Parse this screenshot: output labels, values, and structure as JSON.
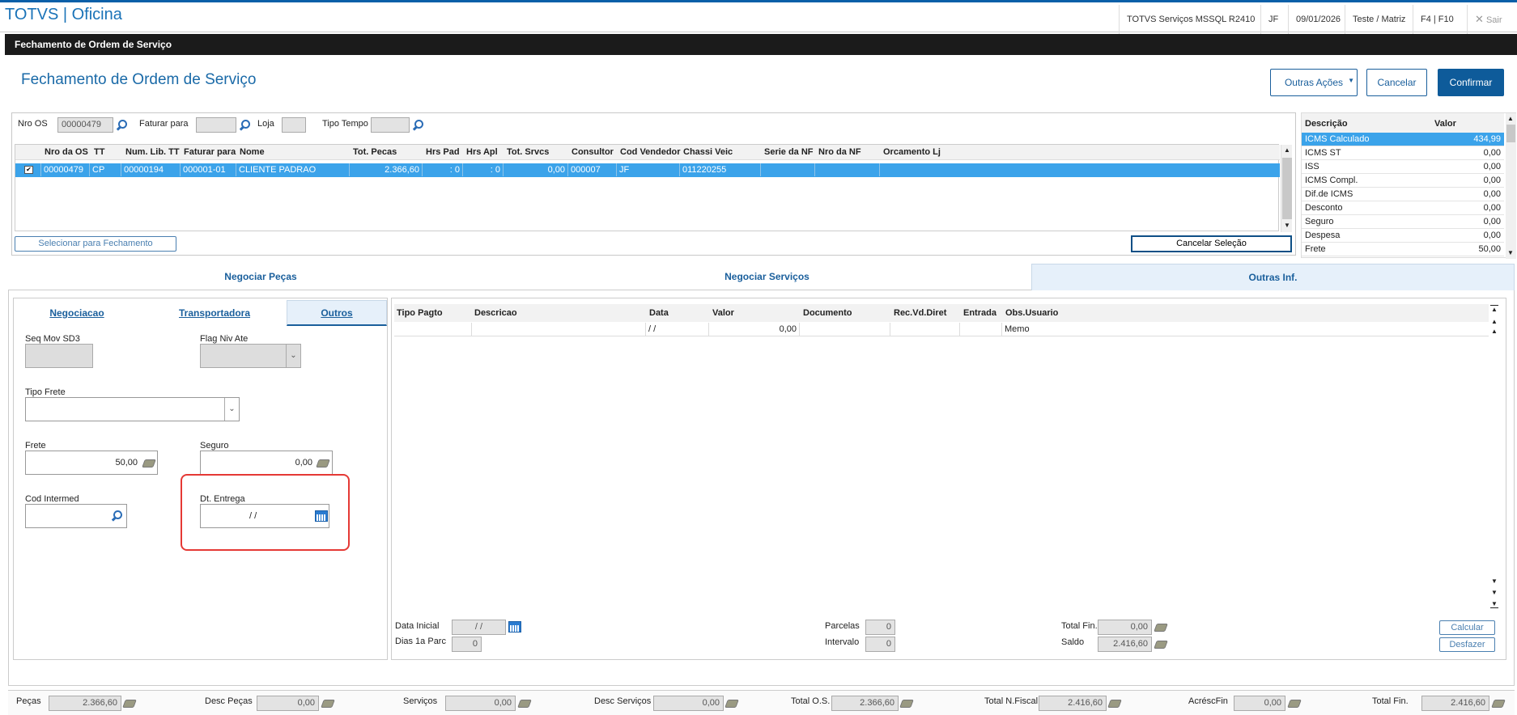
{
  "header": {
    "app_title": "TOTVS | Oficina",
    "items": [
      "TOTVS Serviços MSSQL R2410",
      "JF",
      "09/01/2026",
      "Teste / Matriz",
      "F4 | F10"
    ],
    "exit_label": "Sair"
  },
  "darkbar_title": "Fechamento de Ordem de Serviço",
  "page_title": "Fechamento de Ordem de Serviço",
  "actions": {
    "outras": "Outras Ações",
    "cancelar": "Cancelar",
    "confirmar": "Confirmar"
  },
  "filters": {
    "nro_os_label": "Nro OS",
    "nro_os_value": "00000479",
    "faturar_label": "Faturar para",
    "loja_label": "Loja",
    "tipo_tempo_label": "Tipo Tempo"
  },
  "os_grid": {
    "columns": [
      "Nro da OS",
      "TT",
      "Num. Lib. TT",
      "Faturar para",
      "Nome",
      "Tot. Pecas",
      "Hrs Pad",
      "Hrs Apl",
      "Tot. Srvcs",
      "Consultor",
      "Cod Vendedor",
      "Chassi Veic",
      "Serie da NF",
      "Nro da NF",
      "Orcamento Lj"
    ],
    "row": [
      "00000479",
      "CP",
      "00000194",
      "000001-01",
      "CLIENTE PADRAO",
      "2.366,60",
      ": 0",
      ": 0",
      "0,00",
      "000007",
      "JF",
      "011220255",
      "",
      "",
      ""
    ],
    "btn_selecionar": "Selecionar para Fechamento",
    "btn_cancelar_sel": "Cancelar Seleção"
  },
  "tax_table": {
    "headers": [
      "Descrição",
      "Valor"
    ],
    "rows": [
      [
        "ICMS Calculado",
        "434,99"
      ],
      [
        "ICMS ST",
        "0,00"
      ],
      [
        "ISS",
        "0,00"
      ],
      [
        "ICMS Compl.",
        "0,00"
      ],
      [
        "Dif.de ICMS",
        "0,00"
      ],
      [
        "Desconto",
        "0,00"
      ],
      [
        "Seguro",
        "0,00"
      ],
      [
        "Despesa",
        "0,00"
      ],
      [
        "Frete",
        "50,00"
      ]
    ]
  },
  "main_tabs": [
    "Negociar Peças",
    "Negociar Serviços",
    "Outras Inf."
  ],
  "sub_tabs": [
    "Negociacao",
    "Transportadora",
    "Outros"
  ],
  "outros_form": {
    "seq_mov_label": "Seq Mov SD3",
    "flag_niv_label": "Flag Niv Ate",
    "tipo_frete_label": "Tipo Frete",
    "frete_label": "Frete",
    "frete_value": "50,00",
    "seguro_label": "Seguro",
    "seguro_value": "0,00",
    "cod_intermed_label": "Cod Intermed",
    "dt_entrega_label": "Dt. Entrega",
    "dt_entrega_value": "/  /"
  },
  "pay_grid": {
    "columns": [
      "Tipo Pagto",
      "Descricao",
      "Data",
      "Valor",
      "Documento",
      "Rec.Vd.Diret",
      "Entrada",
      "Obs.Usuario"
    ],
    "row": [
      "",
      "",
      "/ /",
      "0,00",
      "",
      "",
      "",
      "Memo"
    ]
  },
  "pay_footer": {
    "data_inicial_label": "Data Inicial",
    "data_inicial_value": "/  /",
    "dias_label": "Dias 1a Parc",
    "dias_value": "0",
    "parcelas_label": "Parcelas",
    "parcelas_value": "0",
    "intervalo_label": "Intervalo",
    "intervalo_value": "0",
    "total_fin_label": "Total Fin.",
    "total_fin_value": "0,00",
    "saldo_label": "Saldo",
    "saldo_value": "2.416,60",
    "calcular": "Calcular",
    "desfazer": "Desfazer"
  },
  "totals": [
    {
      "label": "Peças",
      "value": "2.366,60"
    },
    {
      "label": "Desc Peças",
      "value": "0,00"
    },
    {
      "label": "Serviços",
      "value": "0,00"
    },
    {
      "label": "Desc Serviços",
      "value": "0,00"
    },
    {
      "label": "Total O.S.",
      "value": "2.366,60"
    },
    {
      "label": "Total N.Fiscal",
      "value": "2.416,60"
    },
    {
      "label": "AcréscFin",
      "value": "0,00"
    },
    {
      "label": "Total Fin.",
      "value": "2.416,60"
    }
  ]
}
